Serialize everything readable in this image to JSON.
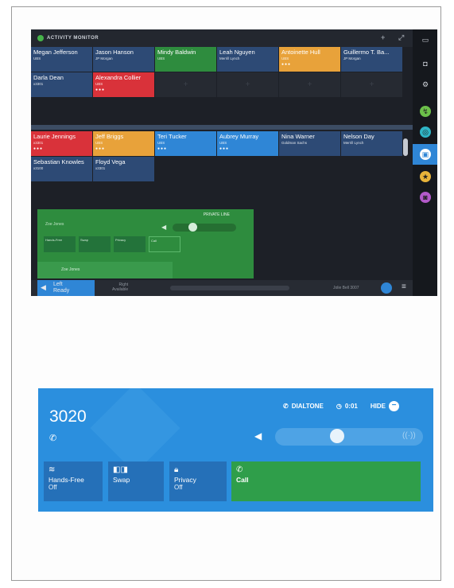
{
  "activity_monitor": {
    "title": "ACTIVITY MONITOR",
    "tiles": [
      {
        "name": "Megan Jefferson",
        "sub": "UBS",
        "color": "#2d4a75"
      },
      {
        "name": "Jason Hanson",
        "sub": "JP Morgan",
        "color": "#2d4a75"
      },
      {
        "name": "Mindy Baldwin",
        "sub": "UBS",
        "color": "#2e8c3e"
      },
      {
        "name": "Leah Nguyen",
        "sub": "Merrill Lynch",
        "color": "#2d4a75"
      },
      {
        "name": "Antoinette Hull",
        "sub": "UBS",
        "color": "#e8a23a"
      },
      {
        "name": "Guillermo T. Ba...",
        "sub": "JP Morgan",
        "color": "#2d4a75"
      },
      {
        "name": "Darla Dean",
        "sub": "x3301",
        "color": "#2d4a75"
      },
      {
        "name": "Alexandra Collier",
        "sub": "UBS",
        "color": "#d9323a"
      },
      {
        "name": "Laurie Jennings",
        "sub": "x3301",
        "color": "#d9323a"
      },
      {
        "name": "Jeff Briggs",
        "sub": "UBS",
        "color": "#e8a23a"
      },
      {
        "name": "Teri Tucker",
        "sub": "UBS",
        "color": "#2f86d6"
      },
      {
        "name": "Aubrey Murray",
        "sub": "UBS",
        "color": "#2f86d6"
      },
      {
        "name": "Nina Warner",
        "sub": "Goldman Sachs",
        "color": "#2d4a75"
      },
      {
        "name": "Nelson Day",
        "sub": "Merrill Lynch",
        "color": "#2d4a75"
      },
      {
        "name": "Sebastian Knowles",
        "sub": "x3100",
        "color": "#2d4a75"
      },
      {
        "name": "Floyd Vega",
        "sub": "x3301",
        "color": "#2d4a75"
      }
    ],
    "call_panel": {
      "status": "PRIVATE LINE",
      "user": "Zoe Jones",
      "buttons": [
        "Hands-Free",
        "Swap",
        "Privacy",
        "Call"
      ],
      "bottom_user": "Zoe Jones"
    },
    "footer": {
      "left": "Left\nReady",
      "right": "Right\nAvailable",
      "info": "Jolie Bell 3007"
    },
    "accent": "#2f86d6"
  },
  "zoom_panel": {
    "extension": "3020",
    "dialtone_label": "DIALTONE",
    "timer": "0:01",
    "hide_label": "HIDE",
    "buttons": [
      {
        "icon": "wifi-icon",
        "label": "Hands-Free",
        "sub": "Off"
      },
      {
        "icon": "swap-icon",
        "label": "Swap",
        "sub": ""
      },
      {
        "icon": "lock-icon",
        "label": "Privacy",
        "sub": "Off"
      },
      {
        "icon": "phone-icon",
        "label": "Call",
        "sub": ""
      }
    ],
    "background": "#2b8fde"
  }
}
